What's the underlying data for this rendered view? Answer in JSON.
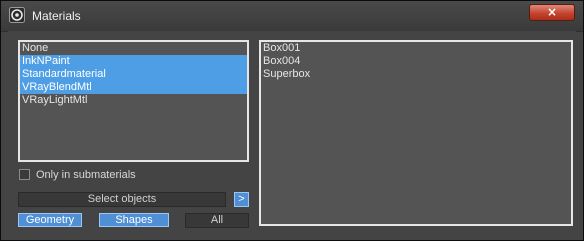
{
  "window": {
    "title": "Materials",
    "close_label": "×"
  },
  "material_list": {
    "items": [
      {
        "label": "None",
        "selected": false
      },
      {
        "label": "InkNPaint",
        "selected": true
      },
      {
        "label": "Standardmaterial",
        "selected": true
      },
      {
        "label": "VRayBlendMtl",
        "selected": true
      },
      {
        "label": "VRayLightMtl",
        "selected": false
      }
    ]
  },
  "object_list": {
    "items": [
      "Box001",
      "Box004",
      "Superbox"
    ]
  },
  "only_in_submaterials": {
    "label": "Only in submaterials",
    "checked": false
  },
  "buttons": {
    "select_objects": "Select objects",
    "arrow": ">",
    "geometry": "Geometry",
    "shapes": "Shapes",
    "all": "All"
  },
  "colors": {
    "selection": "#4e9ee6",
    "panel": "#444444",
    "list_bg": "#545454",
    "close": "#c4452f"
  }
}
